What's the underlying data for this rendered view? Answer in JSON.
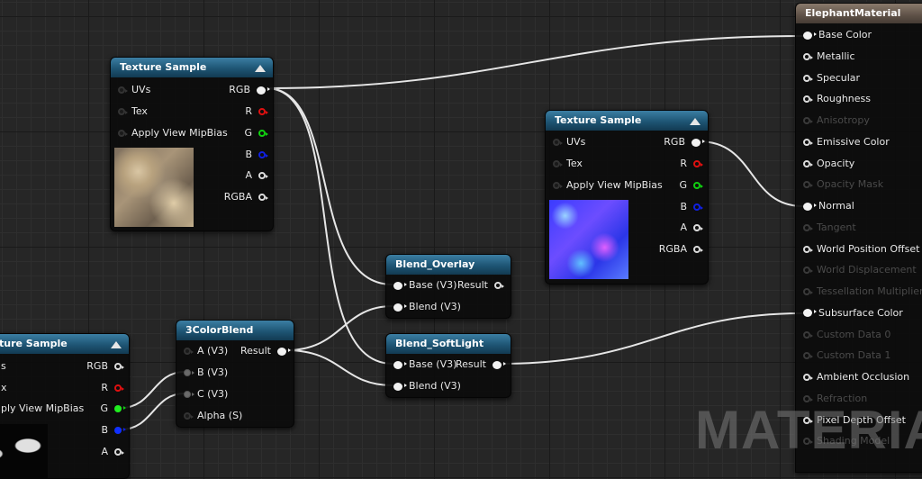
{
  "graph": {
    "watermark": "MATERIAL",
    "nodes": {
      "tex1": {
        "title": "Texture Sample",
        "inputs": [
          "UVs",
          "Tex",
          "Apply View MipBias"
        ],
        "outputs": [
          "RGB",
          "R",
          "G",
          "B",
          "A",
          "RGBA"
        ],
        "thumbnail": "diffuse-texture"
      },
      "tex2": {
        "title": "Texture Sample",
        "inputs": [
          "UVs",
          "Tex",
          "Apply View MipBias"
        ],
        "outputs": [
          "RGB",
          "R",
          "G",
          "B",
          "A",
          "RGBA"
        ],
        "thumbnail": "normal-map-texture"
      },
      "tex3": {
        "title": "ture Sample",
        "inputs": [
          "s",
          "x",
          "ply View MipBias"
        ],
        "outputs": [
          "RGB",
          "R",
          "G",
          "B",
          "A"
        ],
        "thumbnail": "mask-texture"
      },
      "colorblend": {
        "title": "3ColorBlend",
        "inputs": [
          "A (V3)",
          "B (V3)",
          "C (V3)",
          "Alpha (S)"
        ],
        "outputs": [
          "Result"
        ]
      },
      "overlay": {
        "title": "Blend_Overlay",
        "inputs": [
          "Base (V3)",
          "Blend (V3)"
        ],
        "outputs": [
          "Result"
        ]
      },
      "softlight": {
        "title": "Blend_SoftLight",
        "inputs": [
          "Base (V3)",
          "Blend (V3)"
        ],
        "outputs": [
          "Result"
        ]
      },
      "material": {
        "title": "ElephantMaterial",
        "inputs": [
          {
            "label": "Base Color",
            "enabled": true,
            "connected": true
          },
          {
            "label": "Metallic",
            "enabled": true,
            "connected": false
          },
          {
            "label": "Specular",
            "enabled": true,
            "connected": false
          },
          {
            "label": "Roughness",
            "enabled": true,
            "connected": false
          },
          {
            "label": "Anisotropy",
            "enabled": false,
            "connected": false
          },
          {
            "label": "Emissive Color",
            "enabled": true,
            "connected": false
          },
          {
            "label": "Opacity",
            "enabled": true,
            "connected": false
          },
          {
            "label": "Opacity Mask",
            "enabled": false,
            "connected": false
          },
          {
            "label": "Normal",
            "enabled": true,
            "connected": true
          },
          {
            "label": "Tangent",
            "enabled": false,
            "connected": false
          },
          {
            "label": "World Position Offset",
            "enabled": true,
            "connected": false
          },
          {
            "label": "World Displacement",
            "enabled": false,
            "connected": false
          },
          {
            "label": "Tessellation Multiplier",
            "enabled": false,
            "connected": false
          },
          {
            "label": "Subsurface Color",
            "enabled": true,
            "connected": true
          },
          {
            "label": "Custom Data 0",
            "enabled": false,
            "connected": false
          },
          {
            "label": "Custom Data 1",
            "enabled": false,
            "connected": false
          },
          {
            "label": "Ambient Occlusion",
            "enabled": true,
            "connected": false
          },
          {
            "label": "Refraction",
            "enabled": false,
            "connected": false
          },
          {
            "label": "Pixel Depth Offset",
            "enabled": true,
            "connected": false
          },
          {
            "label": "Shading Model",
            "enabled": false,
            "connected": false
          }
        ]
      }
    },
    "pin_colors": {
      "R": "#e01010",
      "G": "#10d010",
      "B": "#1020e0",
      "default": "#dcdcdc"
    }
  }
}
